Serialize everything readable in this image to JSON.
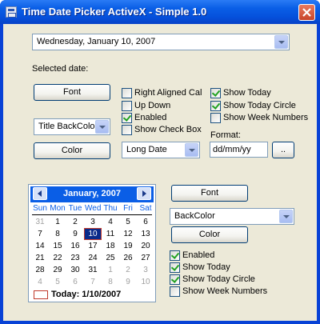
{
  "window": {
    "title": "Time Date Picker ActiveX - Simple 1.0"
  },
  "date_picker": {
    "value": "Wednesday,   January   10, 2007"
  },
  "selected_date_label": "Selected date:",
  "buttons": {
    "font1": "Font",
    "color1": "Color",
    "format_browse": "..",
    "font2": "Font",
    "color2": "Color"
  },
  "combos": {
    "title_backcolor": "Title BackColor",
    "format_style": "Long Date",
    "backcolor": "BackColor"
  },
  "options_mid": [
    {
      "label": "Right Aligned Cal",
      "checked": false
    },
    {
      "label": "Up Down",
      "checked": false
    },
    {
      "label": "Enabled",
      "checked": true
    },
    {
      "label": "Show Check Box",
      "checked": false
    }
  ],
  "options_right": [
    {
      "label": "Show Today",
      "checked": true
    },
    {
      "label": "Show Today Circle",
      "checked": true
    },
    {
      "label": "Show Week Numbers",
      "checked": false
    }
  ],
  "format": {
    "label": "Format:",
    "value": "dd/mm/yy"
  },
  "options_bottom": [
    {
      "label": "Enabled",
      "checked": true
    },
    {
      "label": "Show Today",
      "checked": true
    },
    {
      "label": "Show Today Circle",
      "checked": true
    },
    {
      "label": "Show Week Numbers",
      "checked": false
    }
  ],
  "calendar": {
    "month_title": "January, 2007",
    "weekdays": [
      "Sun",
      "Mon",
      "Tue",
      "Wed",
      "Thu",
      "Fri",
      "Sat"
    ],
    "weeks": [
      [
        "31",
        "1",
        "2",
        "3",
        "4",
        "5",
        "6"
      ],
      [
        "7",
        "8",
        "9",
        "10",
        "11",
        "12",
        "13"
      ],
      [
        "14",
        "15",
        "16",
        "17",
        "18",
        "19",
        "20"
      ],
      [
        "21",
        "22",
        "23",
        "24",
        "25",
        "26",
        "27"
      ],
      [
        "28",
        "29",
        "30",
        "31",
        "1",
        "2",
        "3"
      ],
      [
        "4",
        "5",
        "6",
        "7",
        "8",
        "9",
        "10"
      ]
    ],
    "selected_day": "10",
    "today_label": "Today: 1/10/2007",
    "header_color": "#0a5ee6",
    "selected_color": "#0a2a8a"
  },
  "colors": {
    "titlebar": "#0a5ee6",
    "client_bg": "#ece9d8",
    "close_button": "#d9532c",
    "check_mark": "#21a121"
  }
}
